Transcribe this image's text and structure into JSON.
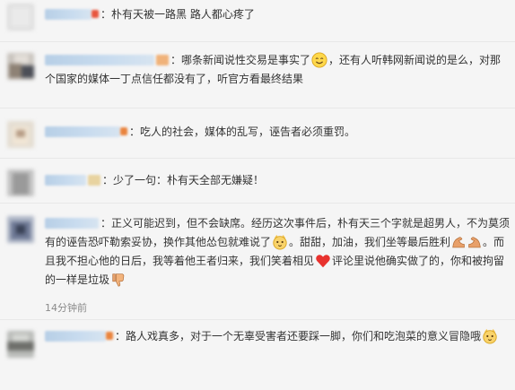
{
  "comments": [
    {
      "text": "：朴有天被一路黑 路人都心疼了"
    },
    {
      "text_a": "：哪条新闻说性交易是事实了",
      "text_b": "，还有人听韩网新闻说的是么，对那个国家的媒体一丁点信任都没有了，听官方看最终结果"
    },
    {
      "text": "：吃人的社会，媒体的乱写，诬告者必须重罚。"
    },
    {
      "text": "：少了一句：朴有天全部无嫌疑！"
    },
    {
      "text_a": "：正义可能迟到，但不会缺席。经历这次事件后，朴有天三个字就是超男人，不为莫须有的诬告恐吓勒索妥协，换作其他怂包就难说了",
      "text_b": "。甜甜，加油，我们坐等最后胜利",
      "text_c": "。而且我不担心他的日后，我等着他王者归来，我们笑着相见",
      "text_d": "评论里说他确实做了的，你和被拘留的一样是垃圾",
      "time": "14分钟前"
    },
    {
      "text": "：路人戏真多，对于一个无辜受害者还要踩一脚，你们和吃泡菜的意义冒隐哦"
    }
  ]
}
